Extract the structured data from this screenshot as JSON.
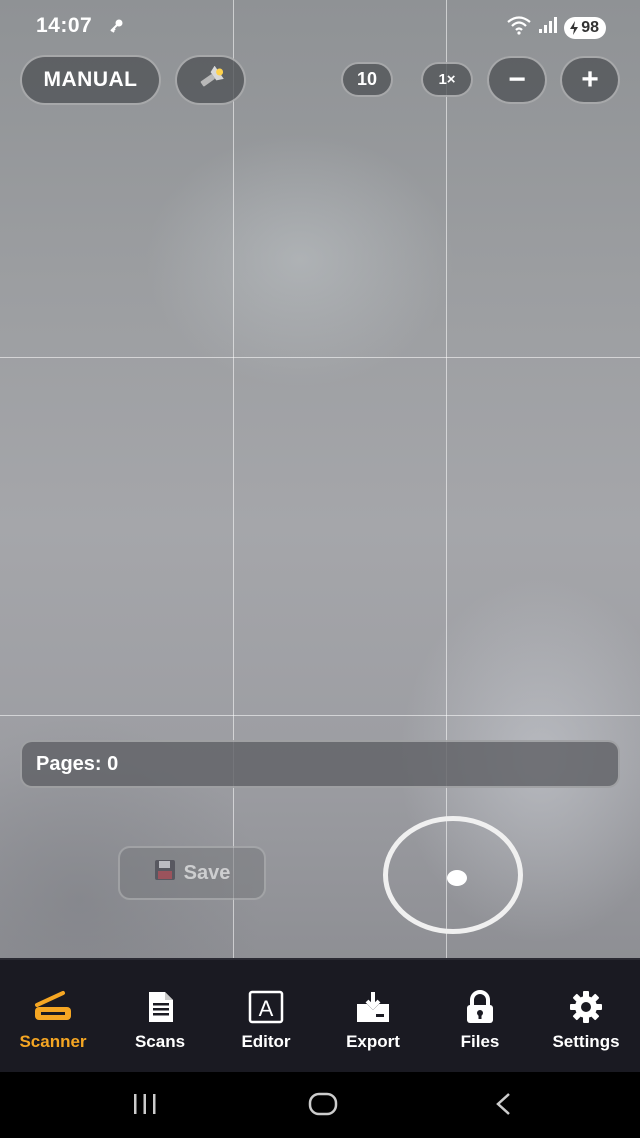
{
  "status_bar": {
    "time": "14:07",
    "battery_level": "98",
    "icons": [
      "key-icon",
      "wifi-icon",
      "signal-icon",
      "battery-charging-icon"
    ]
  },
  "camera_controls": {
    "mode_label": "MANUAL",
    "flash_icon": "flashlight-icon",
    "iso_label": "10",
    "zoom_label": "1×",
    "zoom_out_label": "−",
    "zoom_in_label": "+"
  },
  "pages_label": "Pages: 0",
  "save": {
    "label": "Save",
    "icon": "floppy-disk-icon"
  },
  "tabs": [
    {
      "label": "Scanner",
      "icon": "scanner-icon",
      "active": true
    },
    {
      "label": "Scans",
      "icon": "document-icon",
      "active": false
    },
    {
      "label": "Editor",
      "icon": "text-editor-icon",
      "active": false
    },
    {
      "label": "Export",
      "icon": "export-icon",
      "active": false
    },
    {
      "label": "Files",
      "icon": "lock-icon",
      "active": false
    },
    {
      "label": "Settings",
      "icon": "gear-icon",
      "active": false
    }
  ],
  "colors": {
    "accent": "#f5a623",
    "tabbar_bg": "#1a1a22"
  },
  "system_nav": [
    "recent-apps-icon",
    "home-icon",
    "back-icon"
  ]
}
